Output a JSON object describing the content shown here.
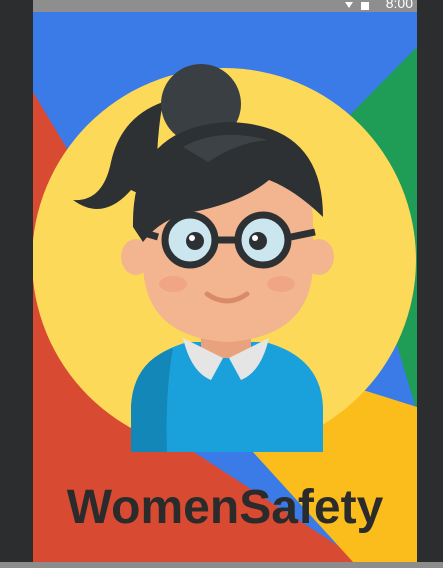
{
  "status_bar": {
    "time": "8:00",
    "icons": [
      "wifi-icon",
      "battery-icon"
    ]
  },
  "splash": {
    "app_name": "WomenSafety",
    "illustration": "woman-avatar-with-glasses"
  },
  "colors": {
    "blue": "#3b7be8",
    "red": "#d84b32",
    "green": "#1f9d57",
    "yellow": "#fbbd1b",
    "circle": "#fdd95a",
    "hair": "#2e3134",
    "skin": "#f3b58f",
    "shirt": "#1aa1dc"
  }
}
